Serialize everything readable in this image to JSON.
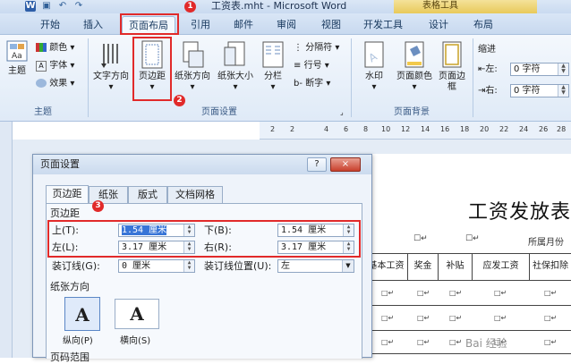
{
  "window": {
    "title": "工资表.mht - Microsoft Word",
    "context_tab_group": "表格工具"
  },
  "qat": {
    "icons": [
      "word-logo-icon",
      "save-icon",
      "undo-icon",
      "redo-icon"
    ],
    "undo_glyph": "↶",
    "redo_glyph": "↷"
  },
  "tabs": [
    "开始",
    "插入",
    "页面布局",
    "引用",
    "邮件",
    "审阅",
    "视图",
    "开发工具",
    "设计",
    "布局"
  ],
  "active_tab": "页面布局",
  "annotations": [
    "1",
    "2",
    "3"
  ],
  "ribbon": {
    "theme_group": {
      "label": "主题",
      "theme_btn": "主题",
      "colors": "颜色",
      "fonts": "字体",
      "effects": "效果"
    },
    "page_setup_group": {
      "label": "页面设置",
      "text_direction": "文字方向",
      "margins": "页边距",
      "orientation": "纸张方向",
      "size": "纸张大小",
      "columns": "分栏",
      "breaks": "分隔符",
      "line_numbers": "行号",
      "hyphenation": "断字"
    },
    "page_background_group": {
      "label": "页面背景",
      "watermark": "水印",
      "page_color": "页面颜色",
      "page_borders": "页面边框"
    },
    "paragraph_group": {
      "indent_label": "缩进",
      "left_label": "左:",
      "left_value": "0 字符",
      "right_label": "右:",
      "right_value": "0 字符"
    }
  },
  "ruler": {
    "marks": [
      "2",
      "2",
      "4",
      "6",
      "8",
      "10",
      "12",
      "14",
      "16",
      "18",
      "20",
      "22",
      "24",
      "26",
      "28"
    ]
  },
  "dialog": {
    "title": "页面设置",
    "help": "?",
    "close": "×",
    "tabs": [
      "页边距",
      "纸张",
      "版式",
      "文档网格"
    ],
    "section_margins": "页边距",
    "top_label": "上(T):",
    "top_value": "1.54 厘米",
    "bottom_label": "下(B):",
    "bottom_value": "1.54 厘米",
    "left_label": "左(L):",
    "left_value": "3.17 厘米",
    "right_label": "右(R):",
    "right_value": "3.17 厘米",
    "gutter_label": "装订线(G):",
    "gutter_value": "0 厘米",
    "gutter_pos_label": "装订线位置(U):",
    "gutter_pos_value": "左",
    "section_orientation": "纸张方向",
    "portrait": "纵向(P)",
    "landscape": "横向(S)",
    "portrait_glyph": "A",
    "landscape_glyph": "A",
    "section_pages": "页码范围"
  },
  "document": {
    "title": "工资发放表",
    "checkbox_glyph": "☐↵",
    "month_label": "所属月份",
    "columns": [
      "基本工资",
      "奖金",
      "补贴",
      "应发工资",
      "社保扣除"
    ],
    "cell_glyph": "□↵"
  },
  "watermark_text": "Bai 经验",
  "colors": {
    "accent_red": "#e12a2a",
    "ribbon_blue": "#dfeaf7",
    "selection": "#3875d7"
  }
}
